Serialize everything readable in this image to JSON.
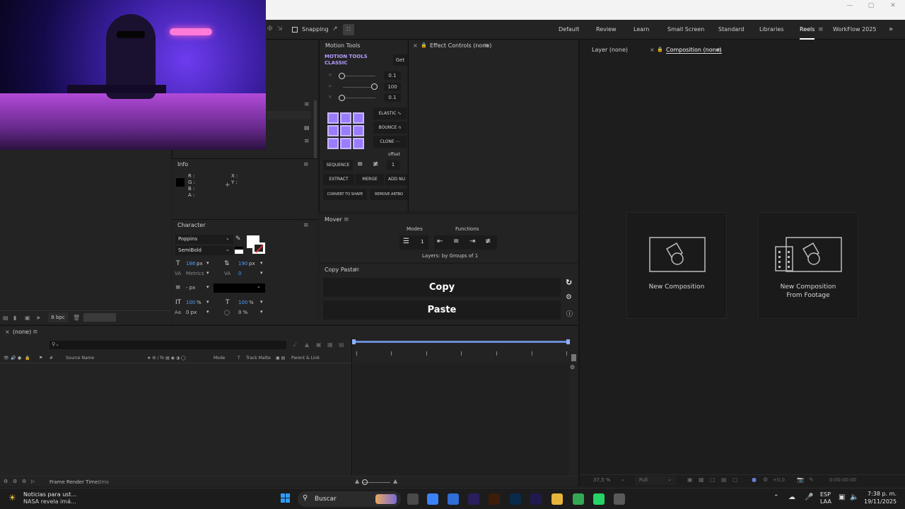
{
  "toolbar": {
    "snapping_label": "Snapping",
    "workspaces": [
      "Default",
      "Review",
      "Learn",
      "Small Screen",
      "Standard",
      "Libraries",
      "Reels",
      "WorkFlow 2025"
    ],
    "active_workspace": "Reels"
  },
  "motion_tools": {
    "title": "Motion Tools",
    "brand_line1": "MOTION TOOLS",
    "brand_line2": "CLASSIC",
    "get_label": "Get",
    "slider1_value": "0.1",
    "slider2_value": "100",
    "slider3_value": "0.1",
    "elastic_label": "ELASTIC",
    "bounce_label": "BOUNCE",
    "clone_label": "CLONE",
    "offset_label": "offset",
    "sequence_label": "SEQUENCE",
    "sequence_value": "1",
    "extract_label": "EXTRACT",
    "merge_label": "MERGE",
    "add_null_label": "ADD NU",
    "convert_label": "CONVERT TO SHAPE",
    "remove_artboard_label": "REMOVE ARTBO"
  },
  "effect_controls": {
    "title": "Effect Controls (none)"
  },
  "viewer": {
    "layer_tab": "Layer (none)",
    "composition_tab": "Composition (none)",
    "new_comp_label": "New Composition",
    "new_comp_footage_line1": "New Composition",
    "new_comp_footage_line2": "From Footage",
    "zoom": "37,5 %",
    "resolution": "Full",
    "exposure": "+0,0",
    "timecode": "0:00:00:00"
  },
  "info": {
    "title": "Info",
    "r": "R :",
    "g": "G :",
    "b": "B :",
    "a": "A :",
    "x": "X :",
    "y": "Y :"
  },
  "character": {
    "title": "Character",
    "font_family": "Poppins",
    "font_style": "SemiBold",
    "font_size": "186",
    "font_size_unit": "px",
    "leading": "190",
    "leading_unit": "px",
    "kerning": "Metrics",
    "tracking": "0",
    "stroke_width": "- px",
    "vert_scale": "100",
    "vert_scale_unit": "%",
    "horiz_scale": "100",
    "horiz_scale_unit": "%",
    "baseline_shift": "0 px",
    "tsume": "0 %",
    "fill_color": "#ffffff"
  },
  "project": {
    "bpc": "8 bpc"
  },
  "mover": {
    "title": "Mover",
    "modes_label": "Modes",
    "functions_label": "Functions",
    "group_value": "1",
    "status": "Layers: by Groups of 1"
  },
  "copy_pasta": {
    "title": "Copy Pasta",
    "copy_label": "Copy",
    "paste_label": "Paste"
  },
  "timeline": {
    "tab_label": "(none)",
    "col_hash": "#",
    "col_source": "Source Name",
    "col_mode": "Mode",
    "col_t": "T",
    "col_trackmatte": "Track Matte",
    "col_parent": "Parent & Link",
    "frame_render_time": "Frame Render Time:",
    "frame_render_value": "0ms"
  },
  "taskbar": {
    "news_line1": "Noticias para ust...",
    "news_line2": "NASA revela imá...",
    "search_placeholder": "Buscar",
    "lang_line1": "ESP",
    "lang_line2": "LAA",
    "time": "7:38 p. m.",
    "date": "19/11/2025",
    "app_icons": [
      {
        "name": "file-explorer-icon",
        "color": "#4a4a4a"
      },
      {
        "name": "copilot-icon",
        "color": "#3b82f6"
      },
      {
        "name": "store-icon",
        "color": "#2f6fd6"
      },
      {
        "name": "premiere-icon",
        "color": "#2a1f5c"
      },
      {
        "name": "illustrator-icon",
        "color": "#3b1d0a"
      },
      {
        "name": "photoshop-icon",
        "color": "#0a2a4a"
      },
      {
        "name": "after-effects-icon",
        "color": "#1f1a4d"
      },
      {
        "name": "folder-icon",
        "color": "#e7b53a"
      },
      {
        "name": "chrome-icon",
        "color": "#34a853"
      },
      {
        "name": "whatsapp-icon",
        "color": "#25d366"
      },
      {
        "name": "settings-icon",
        "color": "#5a5a5a"
      }
    ]
  }
}
